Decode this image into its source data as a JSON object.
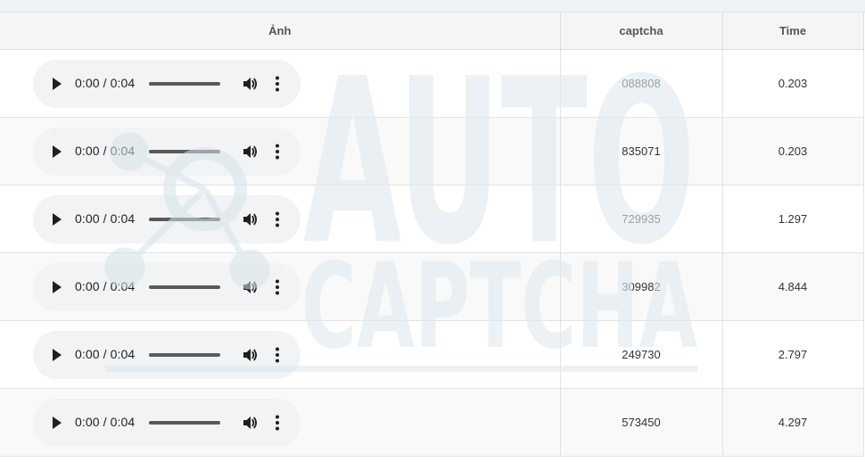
{
  "table": {
    "headers": {
      "image": "Ảnh",
      "captcha": "captcha",
      "time": "Time"
    },
    "rows": [
      {
        "player_time": "0:00 / 0:04",
        "captcha": "088808",
        "time": "0.203"
      },
      {
        "player_time": "0:00 / 0:04",
        "captcha": "835071",
        "time": "0.203"
      },
      {
        "player_time": "0:00 / 0:04",
        "captcha": "729935",
        "time": "1.297"
      },
      {
        "player_time": "0:00 / 0:04",
        "captcha": "309982",
        "time": "4.844"
      },
      {
        "player_time": "0:00 / 0:04",
        "captcha": "249730",
        "time": "2.797"
      },
      {
        "player_time": "0:00 / 0:04",
        "captcha": "573450",
        "time": "4.297"
      }
    ]
  },
  "watermark": {
    "line1": "AUTO",
    "line2": "CAPTCHA"
  },
  "icons": {
    "play": "play-icon",
    "volume": "volume-icon",
    "menu": "more-vert-icon"
  },
  "colors": {
    "header_bg": "#f5f5f5",
    "player_bg": "#f1f3f4",
    "watermark": "#dde7ee"
  }
}
